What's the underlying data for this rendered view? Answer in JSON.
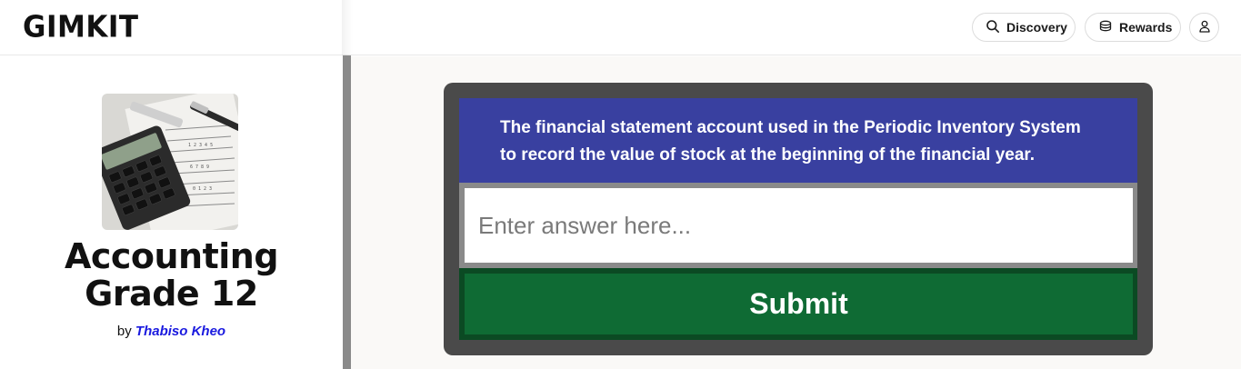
{
  "header": {
    "logo": "GIMKIT",
    "discovery_label": "Discovery",
    "rewards_label": "Rewards",
    "icons": [
      "search-icon",
      "coins-icon",
      "user-icon"
    ]
  },
  "kit": {
    "title_line1": "Accounting",
    "title_line2": "Grade 12",
    "by_label": "by",
    "author": "Thabiso Kheo"
  },
  "question": {
    "text_line1": "The financial statement account used in the Periodic Inventory System",
    "text_line2": "to record the value of stock at the beginning of the financial year.",
    "answer_placeholder": "Enter answer here...",
    "answer_value": "",
    "submit_label": "Submit"
  },
  "colors": {
    "question_bg": "#3940a0",
    "submit_bg": "#0f6b34",
    "card_bg": "#4a4a4a",
    "author_link": "#1a1adf"
  }
}
